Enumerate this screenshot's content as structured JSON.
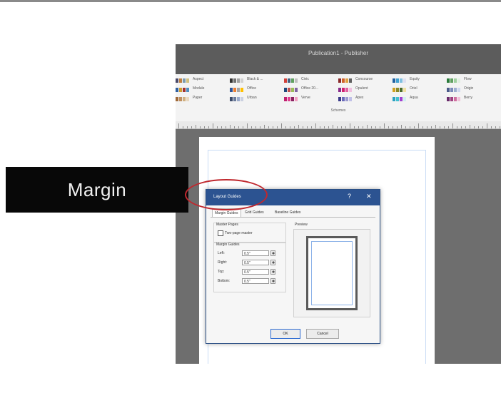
{
  "window": {
    "title": "Publication1 - Publisher"
  },
  "ribbon": {
    "group_label": "Schemes",
    "schemes": [
      {
        "name": "Aspect",
        "colors": [
          "#4a4a6a",
          "#c08040",
          "#7a9ab0",
          "#d0c080"
        ]
      },
      {
        "name": "Black & ...",
        "colors": [
          "#303030",
          "#707070",
          "#a0a0a0",
          "#d0d0d0"
        ]
      },
      {
        "name": "Civic",
        "colors": [
          "#d0403a",
          "#406080",
          "#60a060",
          "#c0c0c0"
        ]
      },
      {
        "name": "Concourse",
        "colors": [
          "#8a2a2a",
          "#d0602a",
          "#e0a040",
          "#606060"
        ]
      },
      {
        "name": "Equity",
        "colors": [
          "#2060a0",
          "#40a0d0",
          "#80c0e0",
          "#e0e0f0"
        ]
      },
      {
        "name": "Flow",
        "colors": [
          "#2a7a3a",
          "#60a060",
          "#a0d0a0",
          "#e0f0e0"
        ]
      },
      {
        "name": "Module",
        "colors": [
          "#3060a0",
          "#d0a030",
          "#a03030",
          "#5090c0"
        ]
      },
      {
        "name": "Office",
        "colors": [
          "#2f5597",
          "#ed7d31",
          "#a5a5a5",
          "#ffc000"
        ]
      },
      {
        "name": "Office 20...",
        "colors": [
          "#1f497d",
          "#c0504d",
          "#9bbb59",
          "#8064a2"
        ]
      },
      {
        "name": "Opulent",
        "colors": [
          "#8a2a8a",
          "#d02070",
          "#e060a0",
          "#f0c0e0"
        ]
      },
      {
        "name": "Oriel",
        "colors": [
          "#d0a020",
          "#8a8a2a",
          "#4a6a2a",
          "#f0e0a0"
        ]
      },
      {
        "name": "Origin",
        "colors": [
          "#4a5a8a",
          "#7a8aba",
          "#a0b0d0",
          "#d0d8f0"
        ]
      },
      {
        "name": "Paper",
        "colors": [
          "#a06a3a",
          "#c09060",
          "#d0b080",
          "#e8d8c0"
        ]
      },
      {
        "name": "Urban",
        "colors": [
          "#3a4a6a",
          "#6a7a9a",
          "#9aaaca",
          "#cad0e0"
        ]
      },
      {
        "name": "Verve",
        "colors": [
          "#c02070",
          "#e04090",
          "#8a2060",
          "#f0a0c0"
        ]
      },
      {
        "name": "Apex",
        "colors": [
          "#3a3a8a",
          "#6a6aba",
          "#9a9ad0",
          "#c0c0e8"
        ]
      },
      {
        "name": "Aqua",
        "colors": [
          "#2aa0c0",
          "#40c0d0",
          "#a040d0",
          "#d0f0f0"
        ]
      },
      {
        "name": "Berry",
        "colors": [
          "#6a2a6a",
          "#a04080",
          "#d070a0",
          "#f0c0d8"
        ]
      }
    ]
  },
  "callout": {
    "label": "Margin"
  },
  "dialog": {
    "title": "Layout Guides",
    "help_glyph": "?",
    "close_glyph": "✕",
    "tabs": [
      "Margin Guides",
      "Grid Guides",
      "Baseline Guides"
    ],
    "master_pages": {
      "title": "Master Pages",
      "two_page_master_label": "Two-page master",
      "two_page_master_checked": false
    },
    "margin_guides": {
      "title": "Margin Guides",
      "fields": [
        {
          "label": "Left:",
          "value": "0.5\""
        },
        {
          "label": "Right:",
          "value": "0.5\""
        },
        {
          "label": "Top:",
          "value": "0.5\""
        },
        {
          "label": "Bottom:",
          "value": "0.5\""
        }
      ]
    },
    "preview": {
      "title": "Preview"
    },
    "ok_label": "OK",
    "cancel_label": "Cancel"
  },
  "colors": {
    "accent": "#2c5391",
    "highlight_circle": "#c0282e",
    "app_background": "#6e6e6e"
  }
}
